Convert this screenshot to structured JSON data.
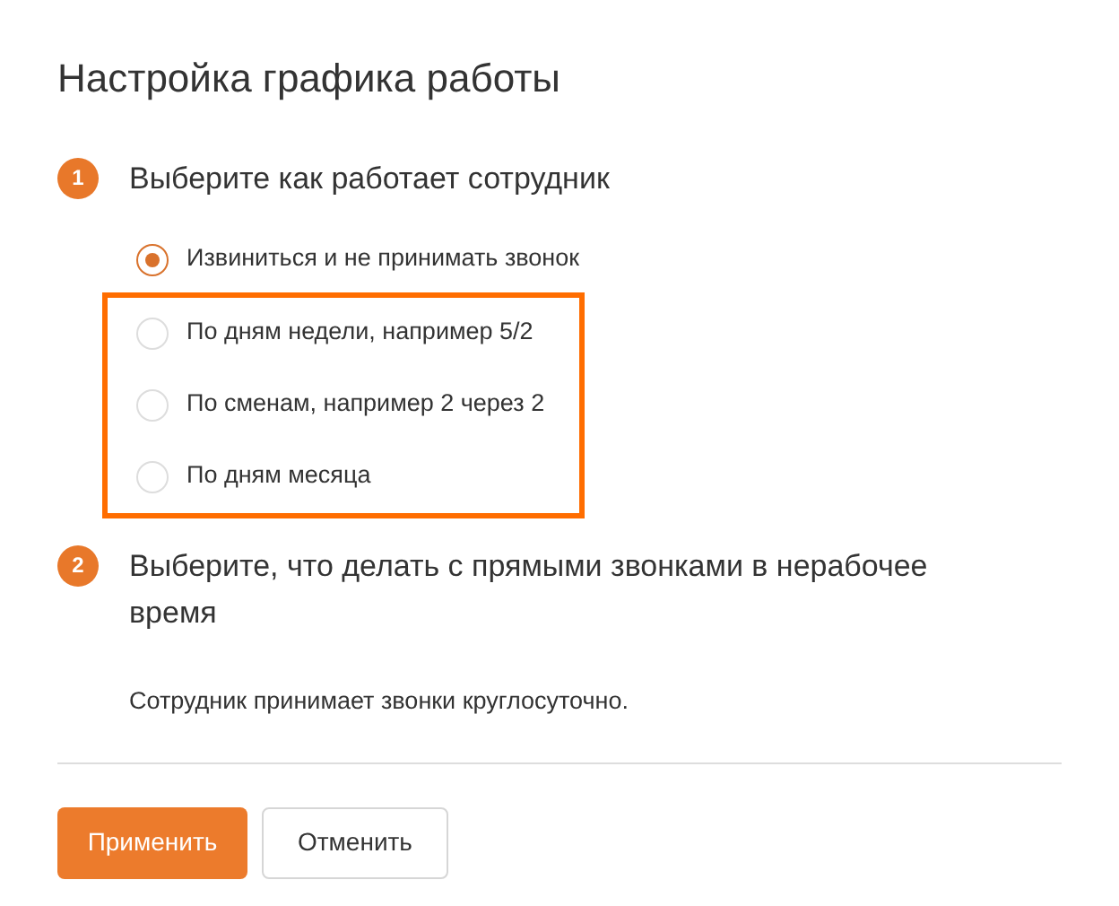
{
  "title": "Настройка графика работы",
  "steps": [
    {
      "number": "1",
      "heading": "Выберите как работает сотрудник",
      "options": [
        {
          "label": "Извиниться и не принимать звонок",
          "selected": true,
          "highlighted": false
        },
        {
          "label": "По дням недели, например 5/2",
          "selected": false,
          "highlighted": true
        },
        {
          "label": "По сменам, например 2 через 2",
          "selected": false,
          "highlighted": true
        },
        {
          "label": "По дням месяца",
          "selected": false,
          "highlighted": true
        }
      ]
    },
    {
      "number": "2",
      "heading": "Выберите, что делать с прямыми звонками в нерабочее время",
      "text": "Сотрудник принимает звонки круглосуточно."
    }
  ],
  "buttons": [
    {
      "label": "Применить",
      "kind": "primary"
    },
    {
      "label": "Отменить",
      "kind": "secondary"
    }
  ]
}
